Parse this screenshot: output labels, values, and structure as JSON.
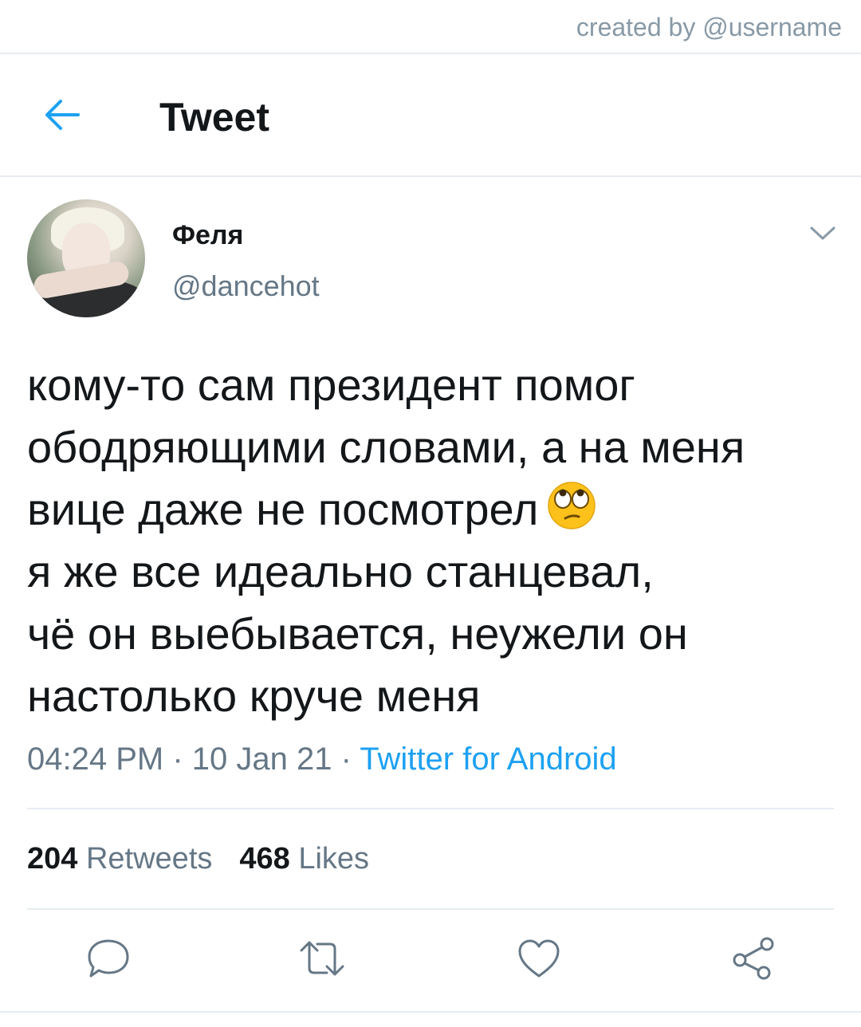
{
  "credit": "created by @username",
  "header": {
    "title": "Tweet",
    "back_icon": "arrow-left-icon"
  },
  "author": {
    "name": "Феля",
    "handle": "@dancehot"
  },
  "tweet": {
    "lines": [
      "кому-то сам президент помог",
      "ободряющими словами, а на меня",
      "вице даже не посмотрел",
      "я же все идеально станцевал,",
      "чё он выебывается, неужели он",
      "настолько круче меня"
    ],
    "emoji": "face-with-rolling-eyes"
  },
  "meta": {
    "time": "04:24 PM",
    "sep1": " · ",
    "date": "10 Jan 21",
    "sep2": " · ",
    "source": "Twitter for Android"
  },
  "stats": {
    "retweets_count": "204",
    "retweets_label": "Retweets",
    "likes_count": "468",
    "likes_label": "Likes"
  },
  "actions": [
    "reply-icon",
    "retweet-icon",
    "like-icon",
    "share-icon"
  ],
  "colors": {
    "accent": "#1da1f2",
    "secondary_text": "#657786",
    "divider": "#e6ecf0"
  }
}
